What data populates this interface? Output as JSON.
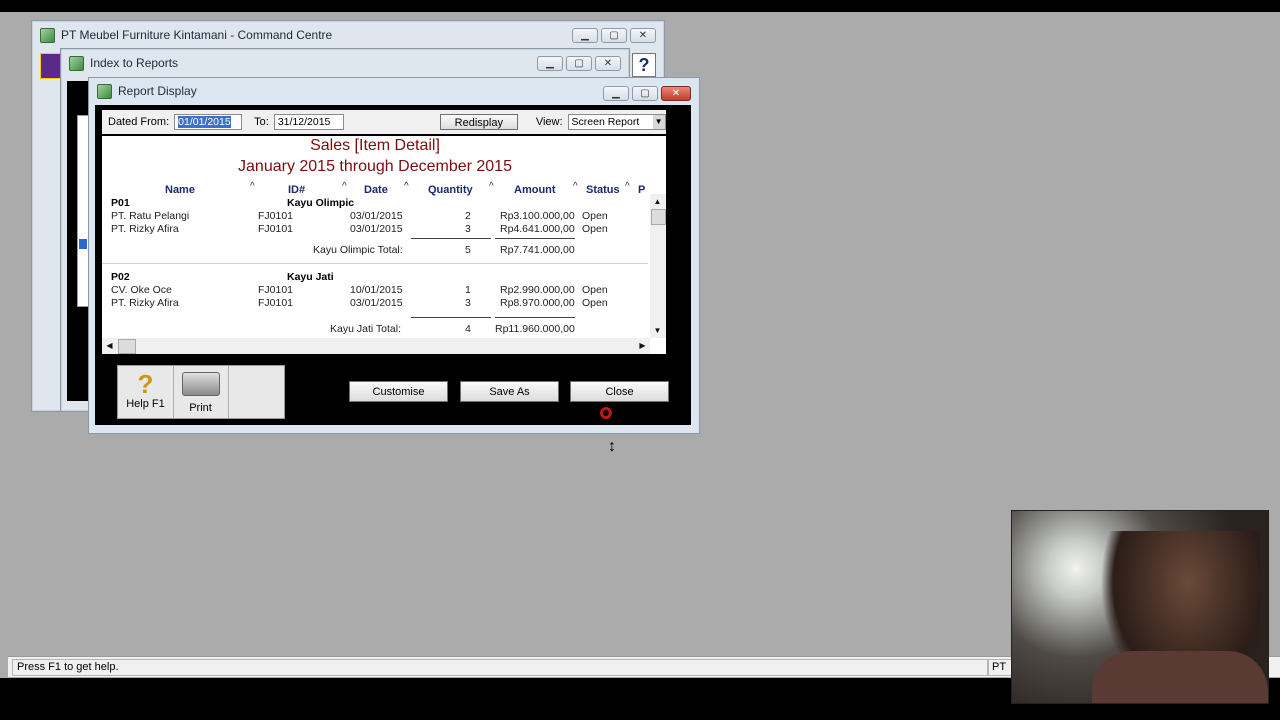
{
  "command_centre": {
    "title": "PT Meubel Furniture Kintamani - Command Centre"
  },
  "index_reports": {
    "title": "Index to Reports"
  },
  "report_window": {
    "title": "Report Display",
    "dated_from_label": "Dated From:",
    "dated_from_value": "01/01/2015",
    "to_label": "To:",
    "to_value": "31/12/2015",
    "redisplay": "Redisplay",
    "view_label": "View:",
    "view_value": "Screen Report"
  },
  "report": {
    "title": "Sales [Item Detail]",
    "subtitle": "January 2015 through December 2015",
    "columns": [
      "Name",
      "ID#",
      "Date",
      "Quantity",
      "Amount",
      "Status",
      "P"
    ],
    "groups": [
      {
        "code": "P01",
        "name": "Kayu Olimpic",
        "rows": [
          {
            "name": "PT. Ratu Pelangi",
            "id": "FJ0101",
            "date": "03/01/2015",
            "qty": "2",
            "amount": "Rp3.100.000,00",
            "status": "Open"
          },
          {
            "name": "PT. Rizky Afira",
            "id": "FJ0101",
            "date": "03/01/2015",
            "qty": "3",
            "amount": "Rp4.641.000,00",
            "status": "Open"
          }
        ],
        "total_label": "Kayu Olimpic Total:",
        "total_qty": "5",
        "total_amount": "Rp7.741.000,00"
      },
      {
        "code": "P02",
        "name": "Kayu Jati",
        "rows": [
          {
            "name": "CV. Oke Oce",
            "id": "FJ0101",
            "date": "10/01/2015",
            "qty": "1",
            "amount": "Rp2.990.000,00",
            "status": "Open"
          },
          {
            "name": "PT. Rizky Afira",
            "id": "FJ0101",
            "date": "03/01/2015",
            "qty": "3",
            "amount": "Rp8.970.000,00",
            "status": "Open"
          }
        ],
        "total_label": "Kayu Jati Total:",
        "total_qty": "4",
        "total_amount": "Rp11.960.000,00"
      }
    ]
  },
  "tools": {
    "help": "Help F1",
    "print": "Print"
  },
  "buttons": {
    "customise": "Customise",
    "save_as": "Save As",
    "close": "Close"
  },
  "status": {
    "help_text": "Press F1 to get help.",
    "right_text": "PT M"
  }
}
